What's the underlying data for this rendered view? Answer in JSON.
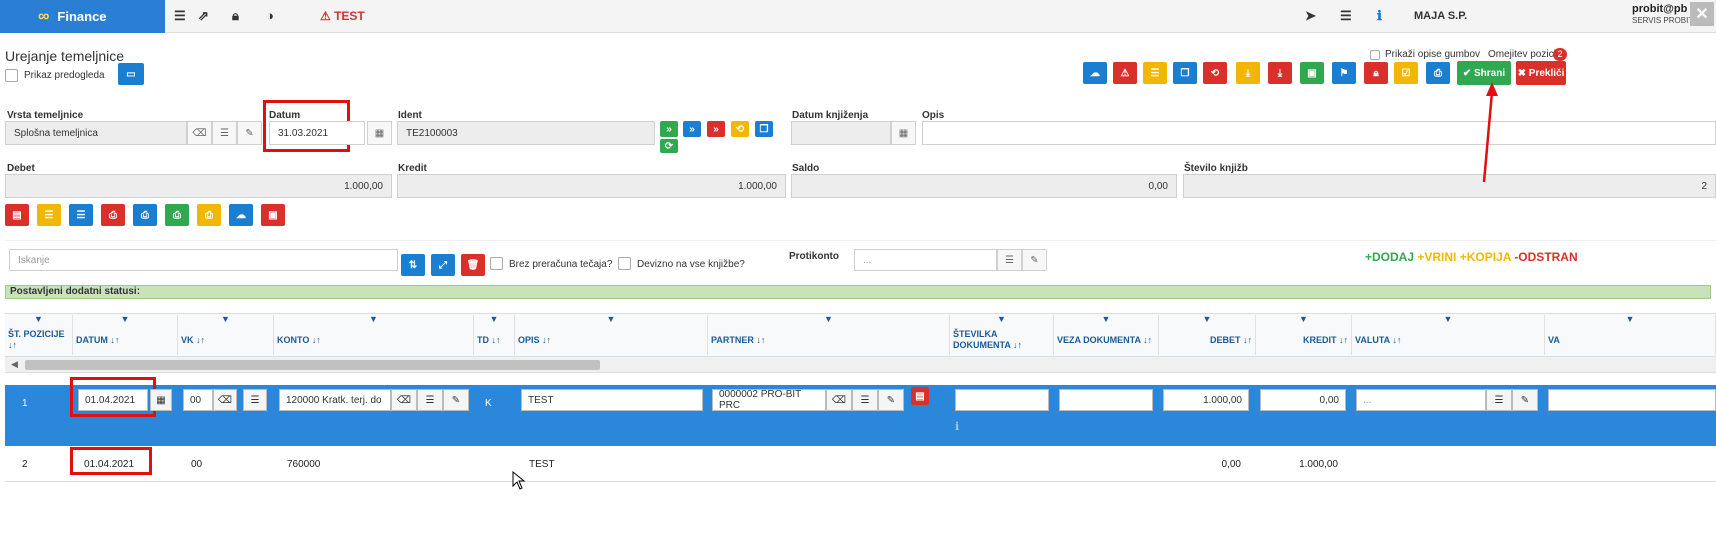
{
  "app": {
    "name": "Finance",
    "test_label": "TEST",
    "company": "MAJA S.P.",
    "user": "probit@pb",
    "user_sub": "SERVIS PROBIT",
    "close": "✕"
  },
  "page": {
    "title": "Urejanje temeljnice",
    "preview_label": "Prikaz predogleda",
    "show_desc_label": "Prikaži opise gumbov",
    "limit_label": "Omejitev pozicij:",
    "limit_badge": "2"
  },
  "actions": {
    "save": "✔ Shrani",
    "cancel": "✖ Prekliči"
  },
  "form": {
    "vrsta_label": "Vrsta temeljnice",
    "vrsta_value": "Splošna temeljnica",
    "datum_label": "Datum",
    "datum_value": "31.03.2021",
    "ident_label": "Ident",
    "ident_value": "TE2100003",
    "datum_knj_label": "Datum knjiženja",
    "datum_knj_value": "",
    "opis_label": "Opis",
    "opis_value": "",
    "debet_label": "Debet",
    "debet_value": "1.000,00",
    "kredit_label": "Kredit",
    "kredit_value": "1.000,00",
    "saldo_label": "Saldo",
    "saldo_value": "0,00",
    "stevilo_label": "Število knjižb",
    "stevilo_value": "2"
  },
  "grid_toolbar": {
    "search_placeholder": "Iskanje",
    "brez_label": "Brez preračuna tečaja?",
    "devizno_label": "Devizno na vse knjižbe?",
    "protikonto_label": "Protikonto",
    "protikonto_placeholder": "...",
    "dodaj": "+DODAJ",
    "vrini": "+VRINI",
    "kopija": "+KOPIJA",
    "odstrani": "-ODSTRAN"
  },
  "status_text": "Postavljeni dodatni statusi:",
  "columns": [
    "ŠT. POZICIJE ↓↑",
    "DATUM ↓↑",
    "VK ↓↑",
    "KONTO ↓↑",
    "TD ↓↑",
    "OPIS ↓↑",
    "PARTNER ↓↑",
    "ŠTEVILKA DOKUMENTA ↓↑",
    "VEZA DOKUMENTA ↓↑",
    "DEBET ↓↑",
    "KREDIT ↓↑",
    "VALUTA ↓↑",
    "VA"
  ],
  "rows": [
    {
      "poz": "1",
      "datum": "01.04.2021",
      "vk": "00",
      "konto": "120000 Kratk. terj. do",
      "td": "K",
      "opis": "TEST",
      "partner": "0000002 PRO-BIT PRC",
      "debet": "1.000,00",
      "kredit": "0,00",
      "valuta": "..."
    },
    {
      "poz": "2",
      "datum": "01.04.2021",
      "vk": "00",
      "konto": "760000",
      "td": "",
      "opis": "TEST",
      "partner": "",
      "debet": "0,00",
      "kredit": "1.000,00",
      "valuta": ""
    }
  ],
  "colors": {
    "blue": "#1a7fd1",
    "red": "#d9302c",
    "yellow": "#f2b705",
    "green": "#2fa84f",
    "highlight": "#e01010"
  }
}
